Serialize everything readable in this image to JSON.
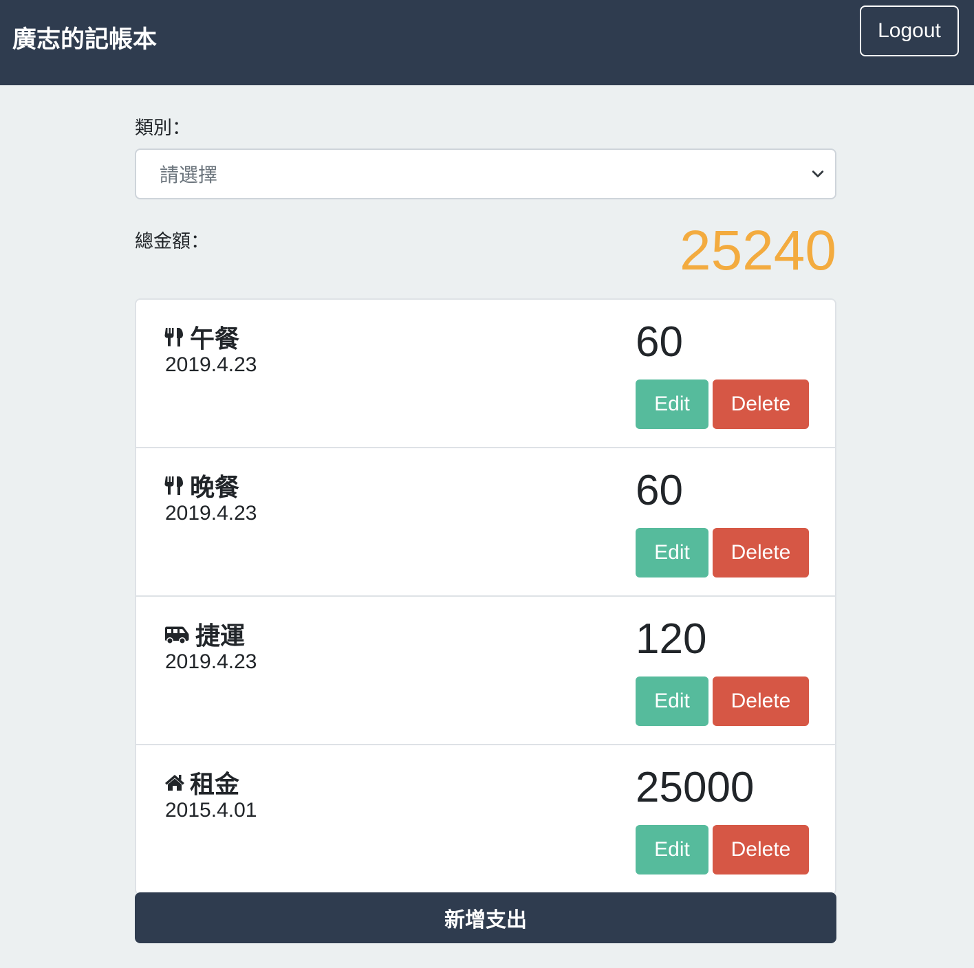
{
  "navbar": {
    "title": "廣志的記帳本",
    "logout_label": "Logout"
  },
  "filter": {
    "label": "類別：",
    "placeholder": "請選擇"
  },
  "total": {
    "label": "總金額：",
    "value": "25240",
    "color": "#f3ab3f"
  },
  "records": [
    {
      "icon": "utensils-icon",
      "name": "午餐",
      "date": "2019.4.23",
      "amount": "60",
      "edit_label": "Edit",
      "delete_label": "Delete"
    },
    {
      "icon": "utensils-icon",
      "name": "晚餐",
      "date": "2019.4.23",
      "amount": "60",
      "edit_label": "Edit",
      "delete_label": "Delete"
    },
    {
      "icon": "shuttle-van-icon",
      "name": "捷運",
      "date": "2019.4.23",
      "amount": "120",
      "edit_label": "Edit",
      "delete_label": "Delete"
    },
    {
      "icon": "home-icon",
      "name": "租金",
      "date": "2015.4.01",
      "amount": "25000",
      "edit_label": "Edit",
      "delete_label": "Delete"
    }
  ],
  "add_button_label": "新增支出",
  "colors": {
    "navbar": "#2f3c4f",
    "background": "#ecf0f1",
    "edit": "#56bb9c",
    "delete": "#d65745"
  }
}
